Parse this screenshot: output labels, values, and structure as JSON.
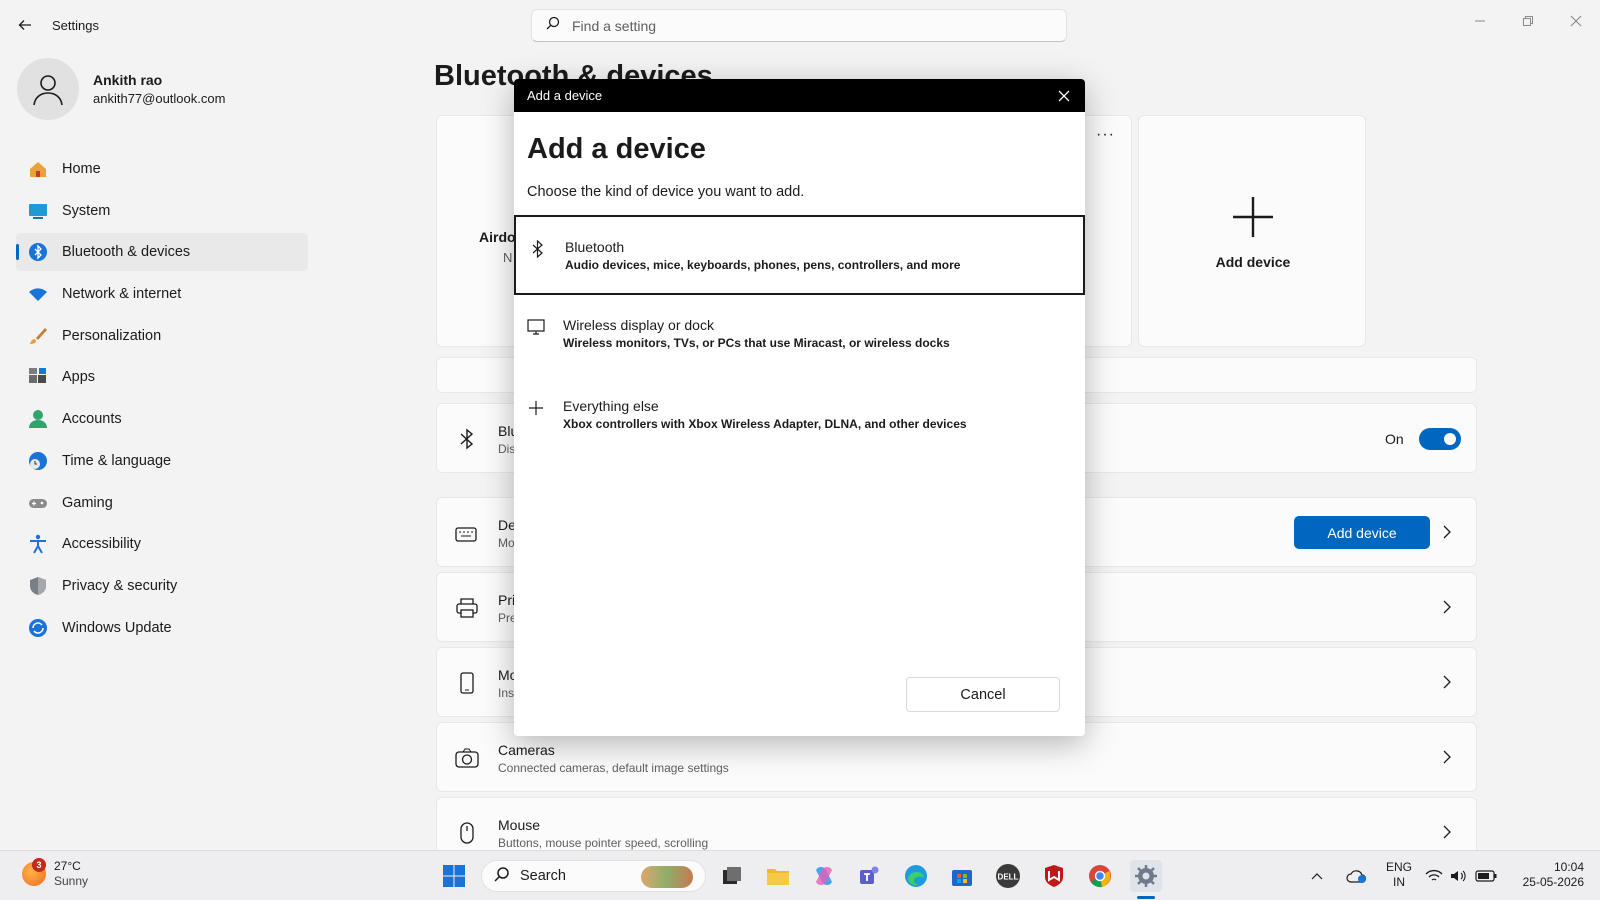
{
  "window": {
    "title": "Settings",
    "search_placeholder": "Find a setting"
  },
  "profile": {
    "name": "Ankith rao",
    "email": "ankith77@outlook.com"
  },
  "sidebar": {
    "items": [
      {
        "label": "Home",
        "icon": "home-icon"
      },
      {
        "label": "System",
        "icon": "system-icon"
      },
      {
        "label": "Bluetooth & devices",
        "icon": "bluetooth-icon",
        "active": true
      },
      {
        "label": "Network & internet",
        "icon": "wifi-icon"
      },
      {
        "label": "Personalization",
        "icon": "brush-icon"
      },
      {
        "label": "Apps",
        "icon": "apps-icon"
      },
      {
        "label": "Accounts",
        "icon": "accounts-icon"
      },
      {
        "label": "Time & language",
        "icon": "globe-clock-icon"
      },
      {
        "label": "Gaming",
        "icon": "gamepad-icon"
      },
      {
        "label": "Accessibility",
        "icon": "accessibility-icon"
      },
      {
        "label": "Privacy & security",
        "icon": "shield-icon"
      },
      {
        "label": "Windows Update",
        "icon": "update-icon"
      }
    ]
  },
  "main": {
    "title": "Bluetooth & devices",
    "device_card": {
      "name_fragment": "Airdo",
      "status_fragment": "N"
    },
    "add_device_tile": {
      "label": "Add device"
    },
    "bluetooth_row": {
      "title_fragment": "Blu",
      "sub_fragment": "Dis",
      "toggle_label": "On",
      "toggle_on": true
    },
    "devices_row": {
      "title_fragment": "De",
      "sub_fragment": "Mo",
      "button": "Add device"
    },
    "printers_row": {
      "title_fragment": "Pri",
      "sub_fragment": "Pre"
    },
    "mobile_row": {
      "title_fragment": "Mo",
      "sub_fragment": "Ins"
    },
    "cameras_row": {
      "title": "Cameras",
      "sub": "Connected cameras, default image settings"
    },
    "mouse_row": {
      "title": "Mouse",
      "sub": "Buttons, mouse pointer speed, scrolling"
    }
  },
  "dialog": {
    "window_title": "Add a device",
    "heading": "Add a device",
    "subtitle": "Choose the kind of device you want to add.",
    "options": [
      {
        "title": "Bluetooth",
        "desc": "Audio devices, mice, keyboards, phones, pens, controllers, and more",
        "icon": "bluetooth-icon",
        "selected": true
      },
      {
        "title": "Wireless display or dock",
        "desc": "Wireless monitors, TVs, or PCs that use Miracast, or wireless docks",
        "icon": "monitor-icon"
      },
      {
        "title": "Everything else",
        "desc": "Xbox controllers with Xbox Wireless Adapter, DLNA, and other devices",
        "icon": "plus-icon"
      }
    ],
    "cancel_label": "Cancel"
  },
  "taskbar": {
    "weather": {
      "temp": "27°C",
      "condition": "Sunny",
      "badge": "3"
    },
    "search_label": "Search",
    "language": {
      "line1": "ENG",
      "line2": "IN"
    },
    "clock": {
      "time": "10:04",
      "date": "25-05-2026"
    }
  },
  "colors": {
    "accent": "#0067c0",
    "background": "#f3f3f3",
    "dialog_titlebar": "#000000"
  }
}
